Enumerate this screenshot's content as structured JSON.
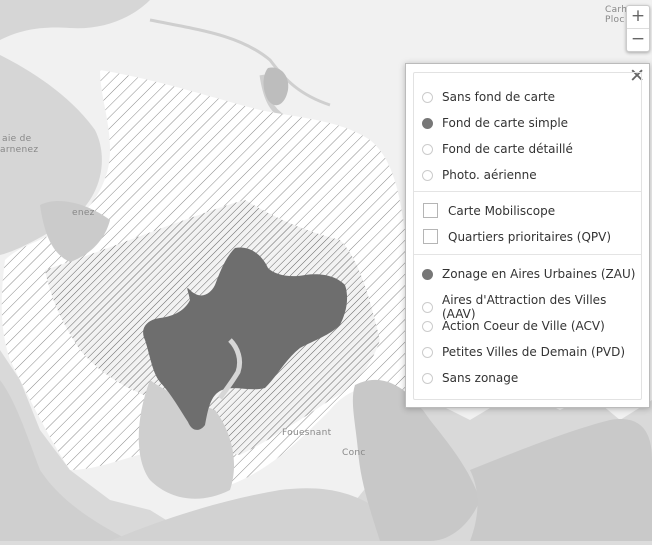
{
  "map": {
    "place_labels": [
      "Carh",
      "Ploc",
      "aie de",
      "arnenez",
      "enez",
      "Fouesnant",
      "Conc"
    ]
  },
  "zoom": {
    "in_label": "+",
    "out_label": "−"
  },
  "layer_panel": {
    "close_label": "✕",
    "basemaps": [
      {
        "label": "Sans fond de carte",
        "selected": false
      },
      {
        "label": "Fond de carte simple",
        "selected": true
      },
      {
        "label": "Fond de carte détaillé",
        "selected": false
      },
      {
        "label": "Photo. aérienne",
        "selected": false
      }
    ],
    "overlays": [
      {
        "label": "Carte Mobiliscope",
        "checked": false
      },
      {
        "label": "Quartiers prioritaires (QPV)",
        "checked": false
      }
    ],
    "zonings": [
      {
        "label": "Zonage en Aires Urbaines (ZAU)",
        "selected": true
      },
      {
        "label": "Aires d'Attraction des Villes (AAV)",
        "selected": false
      },
      {
        "label": "Action Coeur de Ville (ACV)",
        "selected": false
      },
      {
        "label": "Petites Villes de Demain (PVD)",
        "selected": false
      },
      {
        "label": "Sans zonage",
        "selected": false
      }
    ]
  }
}
